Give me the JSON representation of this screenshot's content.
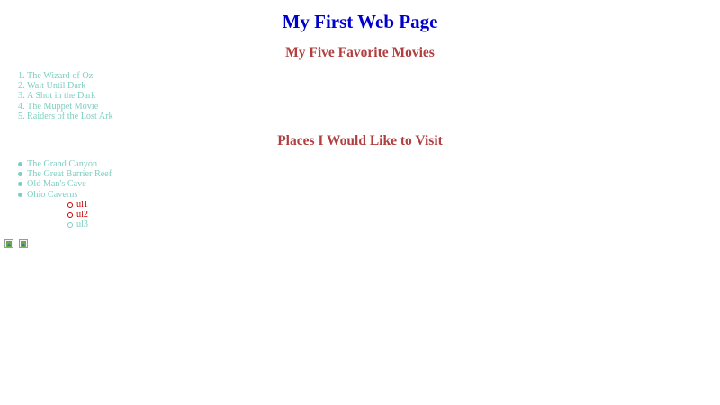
{
  "page": {
    "title": "My First Web Page",
    "movies_heading": "My Five Favorite Movies",
    "movies": [
      {
        "num": "1.",
        "label": "The Wizard of Oz"
      },
      {
        "num": "2.",
        "label": "Wait Until Dark"
      },
      {
        "num": "3.",
        "label": "A Shot in the Dark"
      },
      {
        "num": "4.",
        "label": "The Muppet Movie"
      },
      {
        "num": "5.",
        "label": "Raiders of the Lost Ark"
      }
    ],
    "places_heading": "Places I Would Like to Visit",
    "places": [
      {
        "label": "The Grand Canyon"
      },
      {
        "label": "The Great Barrier Reef"
      },
      {
        "label": "Old Man's Cave"
      },
      {
        "label": "Ohio Caverns"
      }
    ],
    "sublist": [
      {
        "label": "ul1"
      },
      {
        "label": "ul2"
      },
      {
        "label": "ul3"
      }
    ]
  },
  "colors": {
    "title": "#0000cc",
    "heading": "#b04040",
    "list_text": "#7ccfc0",
    "sub_red": "#cc0000"
  },
  "icons": {
    "image_placeholder": "broken-image-icon"
  }
}
